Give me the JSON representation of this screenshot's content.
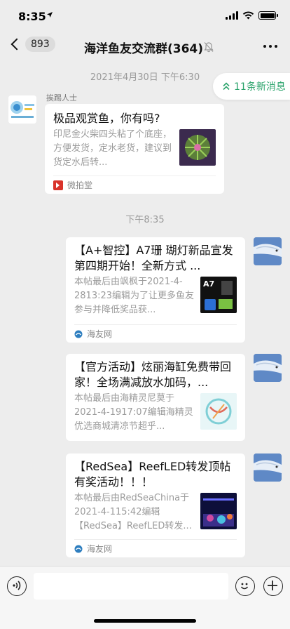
{
  "status": {
    "time": "8:35"
  },
  "nav": {
    "back_count": "893",
    "title": "海洋鱼友交流群(364)"
  },
  "timestamps": {
    "first": "2021年4月30日 下午6:30",
    "second": "下午8:35"
  },
  "new_messages": "11条新消息",
  "messages": [
    {
      "sender": "挨踢人士",
      "title": "极品观赏鱼，你有吗?",
      "desc": "印尼金火柴四头粘了个底座，方便发货，定水老货，建议到货定水后转...",
      "source": "微拍堂"
    },
    {
      "title": "【A+智控】A7珊 瑚灯新品宣发 第四期开始！全新方式 ...",
      "desc": "本帖最后由飒枫于2021-4-2813:23编辑为了让更多鱼友参与并降低奖品获...",
      "thumb_text": "A7",
      "source": "海友网"
    },
    {
      "title": "【官方活动】炫丽海缸免费带回家！全场满减放水加码，...",
      "desc": "本帖最后由海精灵尼莫于2021-4-1917:07编辑海精灵优选商城清凉节超乎...",
      "source": ""
    },
    {
      "title": "【RedSea】ReefLED转发顶帖有奖活动！！！",
      "desc": "本帖最后由RedSeaChina于2021-4-115:42编辑【RedSea】ReefLED转发...",
      "source": "海友网"
    }
  ],
  "colors": {
    "accent_green": "#2aa36b",
    "background": "#ededed",
    "source_red": "#d9342b"
  }
}
